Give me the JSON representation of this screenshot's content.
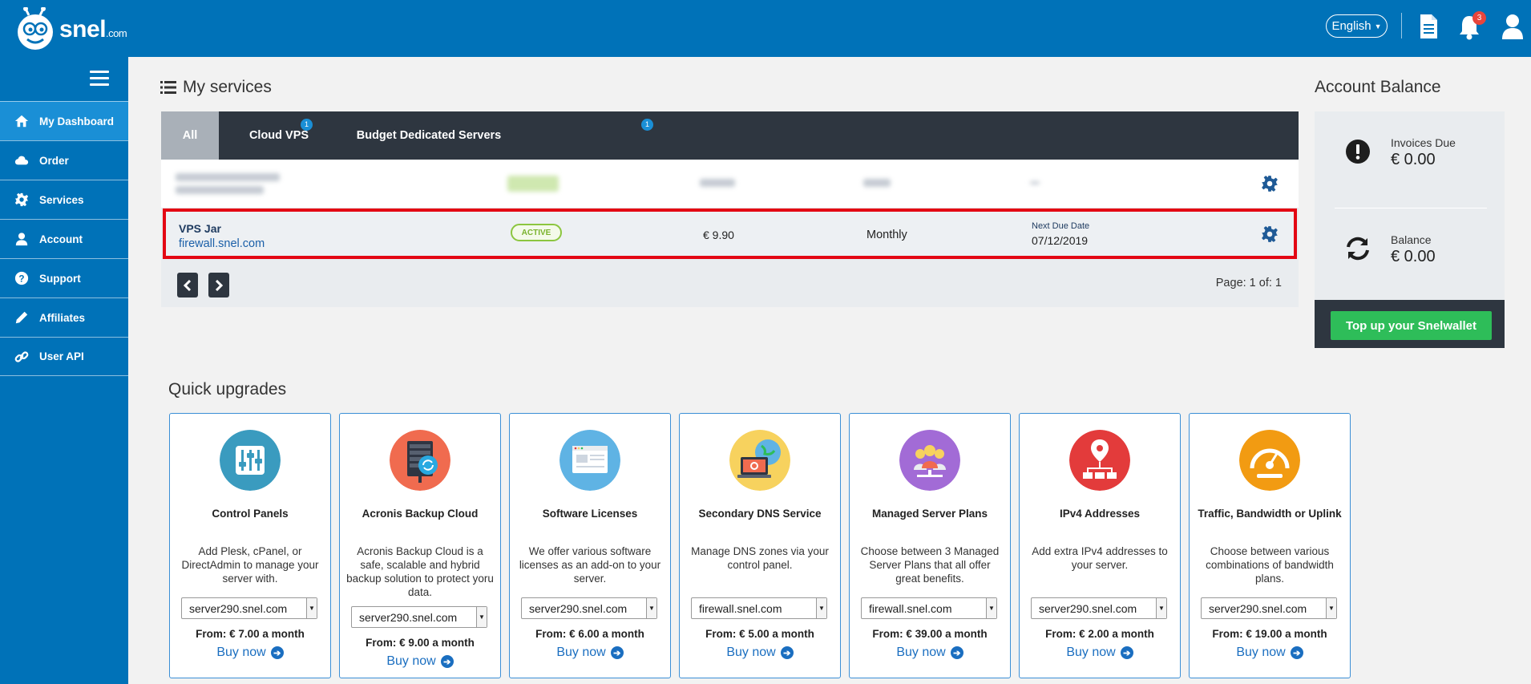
{
  "header": {
    "logo_text": "snel",
    "logo_suffix": ".com",
    "language": "English",
    "notifications_count": "3",
    "icons": [
      "document-icon",
      "bell-icon",
      "user-icon"
    ]
  },
  "sidebar": {
    "items": [
      {
        "label": "My Dashboard",
        "icon": "home-icon",
        "active": true
      },
      {
        "label": "Order",
        "icon": "cloud-icon"
      },
      {
        "label": "Services",
        "icon": "gear-icon"
      },
      {
        "label": "Account",
        "icon": "user-icon"
      },
      {
        "label": "Support",
        "icon": "question-icon"
      },
      {
        "label": "Affiliates",
        "icon": "pencil-icon"
      },
      {
        "label": "User API",
        "icon": "link-icon"
      }
    ]
  },
  "services": {
    "title": "My services",
    "tabs": [
      {
        "label": "All",
        "active": true
      },
      {
        "label": "Cloud VPS",
        "badge": "1"
      },
      {
        "label": "Budget Dedicated Servers",
        "badge": "1"
      }
    ],
    "active_row": {
      "name": "VPS Jar",
      "domain": "firewall.snel.com",
      "status": "ACTIVE",
      "price": "€ 9.90",
      "cycle": "Monthly",
      "due_label": "Next Due Date",
      "due_date": "07/12/2019"
    },
    "page_info": "Page: 1 of: 1"
  },
  "balance": {
    "title": "Account Balance",
    "invoices_label": "Invoices Due",
    "invoices_value": "€ 0.00",
    "balance_label": "Balance",
    "balance_value": "€ 0.00",
    "topup_label": "Top up your Snelwallet"
  },
  "upgrades": {
    "title": "Quick upgrades",
    "buy_label": "Buy now",
    "cards": [
      {
        "name": "Control Panels",
        "desc": "Add Plesk, cPanel, or DirectAdmin to manage your server with.",
        "server": "server290.snel.com",
        "price": "From: € 7.00 a month",
        "color": "#3a9bbf"
      },
      {
        "name": "Acronis Backup Cloud",
        "desc": "Acronis Backup Cloud is a safe, scalable and hybrid backup solution to protect yoru data.",
        "server": "server290.snel.com",
        "price": "From: € 9.00 a month",
        "color": "#f06b4f"
      },
      {
        "name": "Software Licenses",
        "desc": "We offer various software licenses as an add-on to your server.",
        "server": "server290.snel.com",
        "price": "From: € 6.00 a month",
        "color": "#5fb3e4"
      },
      {
        "name": "Secondary DNS Service",
        "desc": "Manage DNS zones via your control panel.",
        "server": "firewall.snel.com",
        "price": "From: € 5.00 a month",
        "color": "#f7d25e"
      },
      {
        "name": "Managed Server Plans",
        "desc": "Choose between 3 Managed Server Plans that all offer great benefits.",
        "server": "firewall.snel.com",
        "price": "From: € 39.00 a month",
        "color": "#a26bd6"
      },
      {
        "name": "IPv4 Addresses",
        "desc": "Add extra IPv4 addresses to your server.",
        "server": "server290.snel.com",
        "price": "From: € 2.00 a month",
        "color": "#e33b3b"
      },
      {
        "name": "Traffic, Bandwidth or Uplink",
        "desc": "Choose between various combinations of bandwidth plans.",
        "server": "server290.snel.com",
        "price": "From: € 19.00 a month",
        "color": "#f29b12"
      }
    ]
  }
}
